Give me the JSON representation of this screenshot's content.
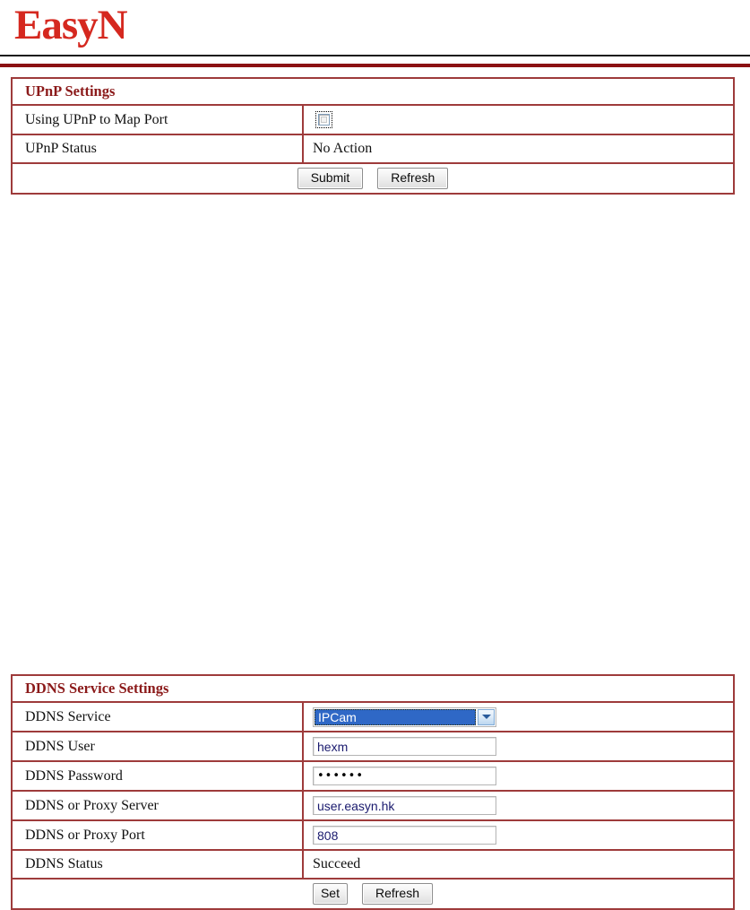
{
  "header": {
    "logo_text": "EasyN"
  },
  "upnp": {
    "title": "UPnP Settings",
    "rows": [
      {
        "label": "Using UPnP to Map Port",
        "type": "checkbox",
        "checked": false
      },
      {
        "label": "UPnP Status",
        "type": "text",
        "value": "No Action"
      }
    ],
    "buttons": {
      "submit_label": "Submit",
      "refresh_label": "Refresh"
    }
  },
  "ddns": {
    "title": "DDNS Service Settings",
    "rows": [
      {
        "label": "DDNS Service",
        "type": "select",
        "value": "IPCam"
      },
      {
        "label": "DDNS User",
        "type": "input",
        "value": "hexm"
      },
      {
        "label": "DDNS Password",
        "type": "password",
        "value": "••••••"
      },
      {
        "label": "DDNS or Proxy Server",
        "type": "input",
        "value": "user.easyn.hk"
      },
      {
        "label": "DDNS or Proxy Port",
        "type": "input",
        "value": "808"
      },
      {
        "label": "DDNS Status",
        "type": "text",
        "value": "Succeed"
      }
    ],
    "buttons": {
      "set_label": "Set",
      "refresh_label": "Refresh"
    }
  },
  "colors": {
    "logo_red": "#d5281f",
    "panel_border": "#9e3b3b",
    "heading_red": "#8b1a1a",
    "rule_red": "#8b1113",
    "select_highlight": "#2f68c6"
  }
}
